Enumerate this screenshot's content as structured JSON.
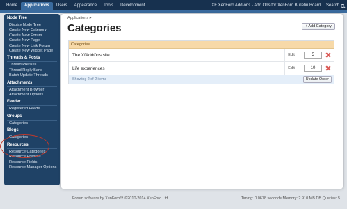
{
  "nav": {
    "tabs": [
      "Home",
      "Applications",
      "Users",
      "Appearance",
      "Tools",
      "Development"
    ],
    "board_title": "XF XenForo Add-ons - Add Ons for XenForo Bulletin Board",
    "search_label": "Search"
  },
  "sidebar": {
    "sections": [
      {
        "title": "Node Tree",
        "links": [
          "Display Node Tree",
          "Create New Category",
          "Create New Forum",
          "Create New Page",
          "Create New Link Forum",
          "Create New Widget Page"
        ]
      },
      {
        "title": "Threads & Posts",
        "links": [
          "Thread Prefixes",
          "Thread Reply Bans",
          "Batch Update Threads"
        ]
      },
      {
        "title": "Attachments",
        "links": [
          "Attachment Browser",
          "Attachment Options"
        ]
      },
      {
        "title": "Feeder",
        "links": [
          "Registered Feeds"
        ]
      },
      {
        "title": "Groups",
        "links": [
          "Categories"
        ]
      },
      {
        "title": "Blogs",
        "links": [
          "Categories"
        ]
      },
      {
        "title": "Resources",
        "links": [
          "Resource Categories",
          "Resource Prefixes",
          "Resource Fields",
          "Resource Manager Options"
        ]
      }
    ]
  },
  "main": {
    "breadcrumb": "Applications ▸",
    "title": "Categories",
    "add_button": "+ Add Category",
    "table_header": "Categories",
    "rows": [
      {
        "name": "The XfAddOns site",
        "edit": "Edit",
        "order": "5"
      },
      {
        "name": "Life experiences",
        "edit": "Edit",
        "order": "10"
      }
    ],
    "showing": "Showing 2 of 2 items",
    "update_button": "Update Order"
  },
  "footer": {
    "copyright": "Forum software by XenForo™ ©2010-2014 XenForo Ltd.",
    "timing": "Timing: 0.0678 seconds Memory: 2.910 MB DB Queries: 5"
  },
  "colors": {
    "topbar": "#17314f",
    "accent": "#3a6b9e",
    "sidebar": "#1f4266",
    "table_header": "#f7d9a8",
    "delete": "#d9534f",
    "highlight_circle": "#c0392b"
  }
}
